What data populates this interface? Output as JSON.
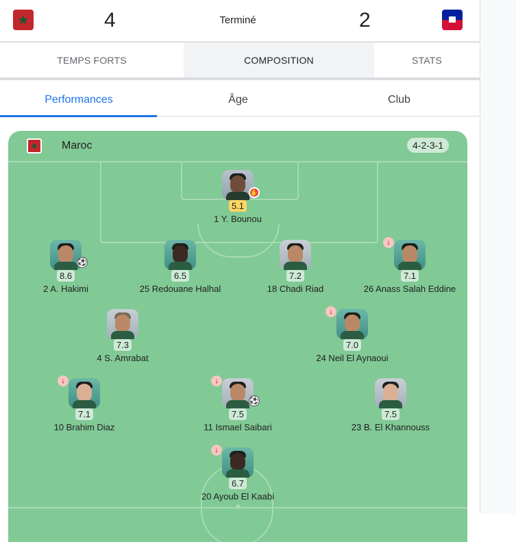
{
  "header": {
    "home_score": "4",
    "status": "Terminé",
    "away_score": "2",
    "home_flag_icon": "morocco-flag-icon",
    "away_flag_icon": "haiti-flag-icon"
  },
  "main_tabs": [
    {
      "label": "TEMPS FORTS",
      "active": false
    },
    {
      "label": "COMPOSITION",
      "active": true
    },
    {
      "label": "STATS",
      "active": false
    }
  ],
  "sub_tabs": [
    {
      "label": "Performances",
      "active": true
    },
    {
      "label": "Âge",
      "active": false
    },
    {
      "label": "Club",
      "active": false
    }
  ],
  "lineup": {
    "team_name": "Maroc",
    "formation": "4-2-3-1",
    "players": [
      {
        "number": "1",
        "name": "Y. Bounou",
        "label": "1 Y. Bounou",
        "rating": "5.1",
        "badge": "goalkeeper-glove-icon",
        "subbed": false
      },
      {
        "number": "2",
        "name": "A. Hakimi",
        "label": "2 A. Hakimi",
        "rating": "8.6",
        "badge": "goal-ball-icon",
        "subbed": false
      },
      {
        "number": "25",
        "name": "Redouane Halhal",
        "label": "25 Redouane Halhal",
        "rating": "6.5",
        "badge": "",
        "subbed": false
      },
      {
        "number": "18",
        "name": "Chadi Riad",
        "label": "18 Chadi Riad",
        "rating": "7.2",
        "badge": "",
        "subbed": false
      },
      {
        "number": "26",
        "name": "Anass Salah Eddine",
        "label": "26 Anass Salah Eddine",
        "rating": "7.1",
        "badge": "",
        "subbed": true
      },
      {
        "number": "4",
        "name": "S. Amrabat",
        "label": "4 S. Amrabat",
        "rating": "7.3",
        "badge": "",
        "subbed": false
      },
      {
        "number": "24",
        "name": "Neil El Aynaoui",
        "label": "24 Neil El Aynaoui",
        "rating": "7.0",
        "badge": "",
        "subbed": true
      },
      {
        "number": "10",
        "name": "Brahim Diaz",
        "label": "10 Brahim Diaz",
        "rating": "7.1",
        "badge": "",
        "subbed": true
      },
      {
        "number": "11",
        "name": "Ismael Saibari",
        "label": "11 Ismael Saibari",
        "rating": "7.5",
        "badge": "goal-ball-icon",
        "subbed": true
      },
      {
        "number": "23",
        "name": "B. El Khannouss",
        "label": "23 B. El Khannouss",
        "rating": "7.5",
        "badge": "",
        "subbed": false
      },
      {
        "number": "20",
        "name": "Ayoub El Kaabi",
        "label": "20 Ayoub El Kaabi",
        "rating": "6.7",
        "badge": "",
        "subbed": true
      }
    ]
  }
}
